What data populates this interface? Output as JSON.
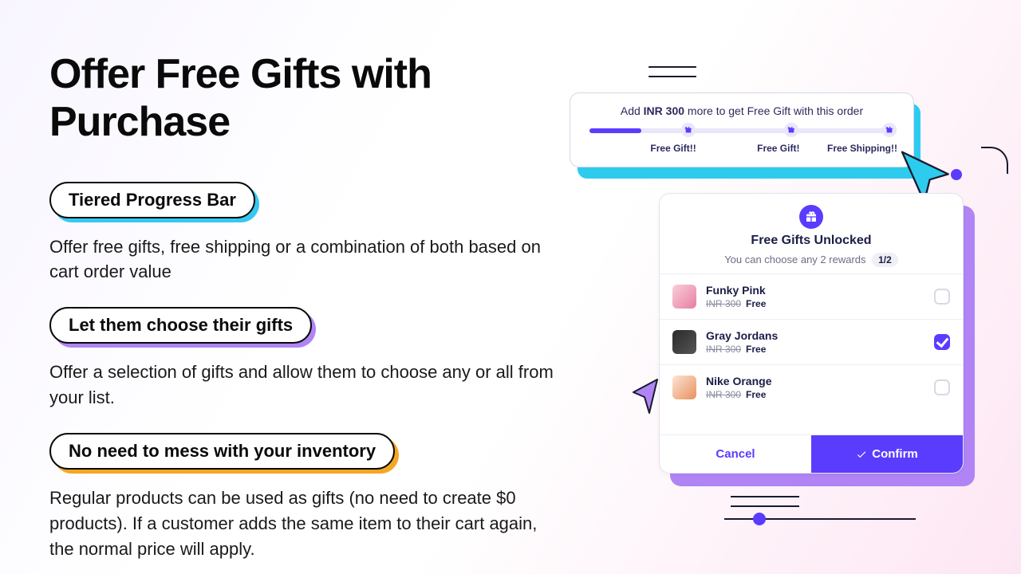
{
  "title": "Offer Free Gifts with Purchase",
  "features": [
    {
      "pill": "Tiered Progress Bar",
      "desc": "Offer free gifts, free shipping or a combination of both based on cart order value",
      "accent": "#36c8f0"
    },
    {
      "pill": "Let them choose their gifts",
      "desc": "Offer a selection of gifts and allow them to choose any or all from your list.",
      "accent": "#b084f5"
    },
    {
      "pill": "No need to mess with your inventory",
      "desc": "Regular products can be used as gifts (no need to create $0 products). If a customer adds the same item to their cart again, the normal price will apply.",
      "accent": "#f5a623"
    }
  ],
  "progress": {
    "msg_pre": "Add ",
    "amount": "INR 300",
    "msg_post": " more to get Free Gift with this order",
    "labels": [
      "Free Gift!!",
      "Free Gift!",
      "Free Shipping!!"
    ]
  },
  "modal": {
    "title": "Free Gifts Unlocked",
    "subtitle": "You can choose any 2 rewards",
    "count": "1/2",
    "cancel": "Cancel",
    "confirm": "Confirm",
    "gifts": [
      {
        "name": "Funky Pink",
        "strike": "INR 300",
        "free": "Free",
        "selected": false
      },
      {
        "name": "Gray Jordans",
        "strike": "INR 300",
        "free": "Free",
        "selected": true
      },
      {
        "name": "Nike Orange",
        "strike": "INR 300",
        "free": "Free",
        "selected": false
      }
    ]
  }
}
